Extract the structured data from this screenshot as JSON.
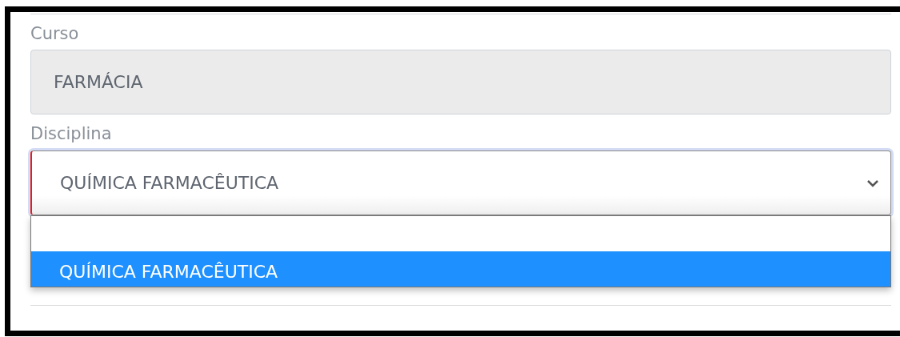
{
  "course_field": {
    "label": "Curso",
    "value": "FARMÁCIA",
    "disabled": true
  },
  "discipline_select": {
    "label": "Disciplina",
    "value": "QUÍMICA FARMACÊUTICA",
    "invalid": true,
    "expanded": true,
    "options": [
      {
        "selected": false
      },
      {
        "label": "QUÍMICA FARMACÊUTICA",
        "selected": true
      }
    ]
  }
}
